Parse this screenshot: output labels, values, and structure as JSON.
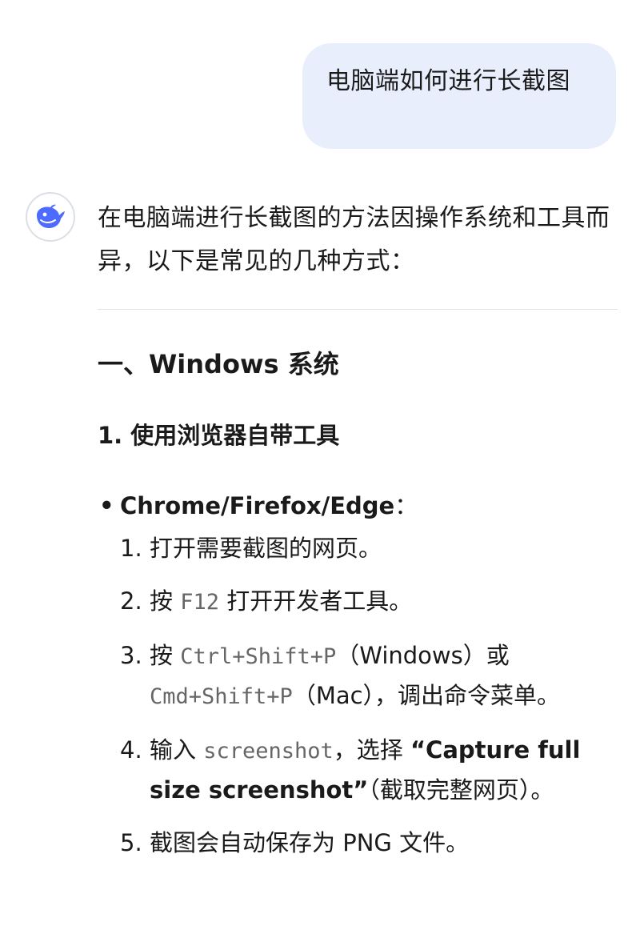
{
  "user_message": "电脑端如何进行长截图",
  "assistant": {
    "intro": "在电脑端进行长截图的方法因操作系统和工具而异，以下是常见的几种方式：",
    "section_title": "一、Windows 系统",
    "subsection_title": "1. 使用浏览器自带工具",
    "bullet": {
      "label": "Chrome/Firefox/Edge",
      "suffix": "："
    },
    "steps": {
      "s1": {
        "num": "1.",
        "text": "打开需要截图的网页。"
      },
      "s2": {
        "num": "2.",
        "pre": "按 ",
        "code": "F12",
        "post": " 打开开发者工具。"
      },
      "s3": {
        "num": "3.",
        "pre": "按 ",
        "code1": "Ctrl+Shift+P",
        "mid": "（Windows）或",
        "code2": "Cmd+Shift+P",
        "post": "（Mac），调出命令菜单。"
      },
      "s4": {
        "num": "4.",
        "pre": "输入 ",
        "code": "screenshot",
        "mid": "，选择 ",
        "bold": "“Capture full size screenshot”",
        "post": "（截取完整网页）。"
      },
      "s5": {
        "num": "5.",
        "text": "截图会自动保存为 PNG 文件。"
      }
    }
  },
  "colors": {
    "user_bubble": "#e8eefc",
    "code_text": "#666666",
    "avatar_brand": "#4d6bfe"
  }
}
